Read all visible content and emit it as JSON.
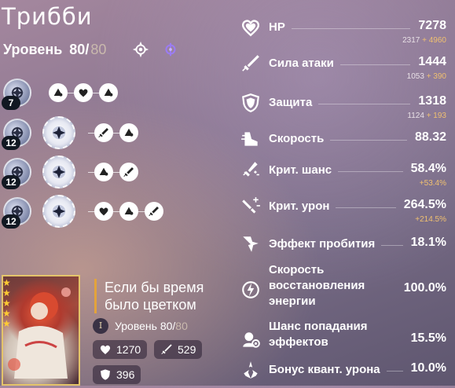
{
  "character": {
    "name": "Трибби",
    "level_prefix": "Уровень",
    "level_current": "80/",
    "level_max": "80",
    "path_icon": "remembrance-path-icon",
    "element_icon": "quantum-element-icon"
  },
  "traces": [
    {
      "skill_level": "7",
      "nodes": [
        "hp-bonus",
        "heart",
        "hp-bonus"
      ]
    },
    {
      "skill_level": "12",
      "nodes": [
        "major",
        "atk",
        "hp-bonus"
      ]
    },
    {
      "skill_level": "12",
      "nodes": [
        "major",
        "hp-bonus",
        "atk"
      ]
    },
    {
      "skill_level": "12",
      "nodes": [
        "major",
        "heart",
        "hp-bonus",
        "atk"
      ]
    }
  ],
  "stats": [
    {
      "label": "HP",
      "value": "7278",
      "base": "2317",
      "plus": "+ 4960",
      "icon": "hp-heart-icon"
    },
    {
      "label": "Сила атаки",
      "value": "1444",
      "base": "1053",
      "plus": "+ 390",
      "icon": "atk-sword-icon"
    },
    {
      "label": "Защита",
      "value": "1318",
      "base": "1124",
      "plus": "+ 193",
      "icon": "def-shield-icon"
    },
    {
      "label": "Скорость",
      "value": "88.32",
      "icon": "spd-boot-icon"
    },
    {
      "label": "Крит. шанс",
      "value": "58.4%",
      "bonus": "+53.4%",
      "icon": "crit-rate-icon"
    },
    {
      "label": "Крит. урон",
      "value": "264.5%",
      "bonus": "+214.5%",
      "icon": "crit-dmg-icon"
    },
    {
      "label": "Эффект пробития",
      "value": "18.1%",
      "icon": "break-effect-icon"
    },
    {
      "label_lines": [
        "Скорость",
        "восстановления",
        "энергии"
      ],
      "value": "100.0%",
      "icon": "energy-regen-icon"
    },
    {
      "label_lines": [
        "Шанс попадания",
        "эффектов"
      ],
      "value": "15.5%",
      "icon": "effect-hit-icon"
    },
    {
      "label": "Бонус квант. урона",
      "value": "10.0%",
      "icon": "quantum-dmg-icon"
    }
  ],
  "light_cone": {
    "title_line1": "Если бы время",
    "title_line2": "было цветком",
    "rank": "I",
    "level_prefix": "Уровень",
    "level_current": "80/",
    "level_max": "80",
    "hp": "1270",
    "atk": "529",
    "def": "396",
    "stars": 5
  },
  "colors": {
    "accent_gold": "#f0c070",
    "stars": "#ffcc33"
  }
}
